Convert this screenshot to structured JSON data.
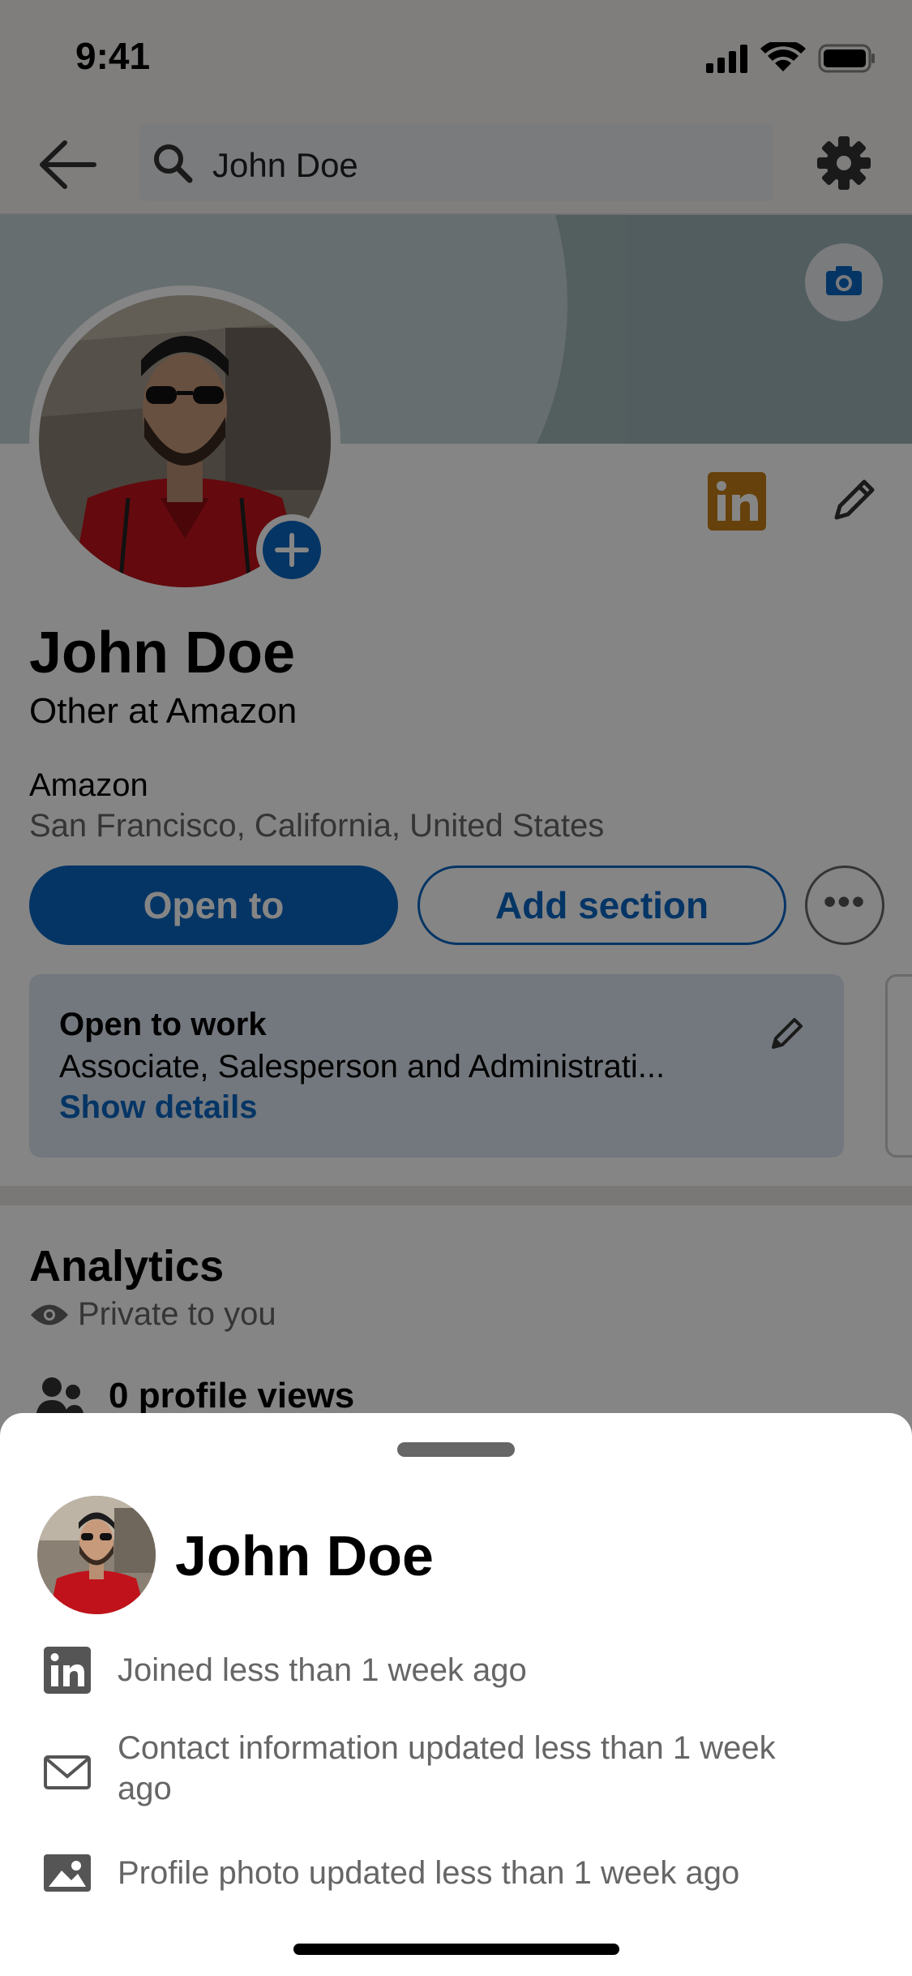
{
  "status_bar": {
    "time": "9:41"
  },
  "top_nav": {
    "search_value": "John Doe"
  },
  "profile": {
    "name": "John Doe",
    "headline": "Other at Amazon",
    "company": "Amazon",
    "location": "San Francisco, California, United States"
  },
  "actions": {
    "open_to_label": "Open to",
    "add_section_label": "Add section",
    "more_label": "•••"
  },
  "open_to_work": {
    "title": "Open to work",
    "roles": "Associate, Salesperson and Administrati...",
    "link": "Show details"
  },
  "analytics": {
    "title": "Analytics",
    "privacy": "Private to you",
    "profile_views": "0 profile views"
  },
  "sheet": {
    "name": "John Doe",
    "rows": [
      {
        "icon": "linkedin-icon",
        "text": "Joined less than 1 week ago"
      },
      {
        "icon": "mail-icon",
        "text": "Contact information updated less than 1 week ago"
      },
      {
        "icon": "image-icon",
        "text": "Profile photo updated less than 1 week ago"
      }
    ]
  },
  "colors": {
    "brand_blue": "#0a66c2",
    "linkedin_badge": "#c37d16",
    "muted_text": "#666666"
  }
}
